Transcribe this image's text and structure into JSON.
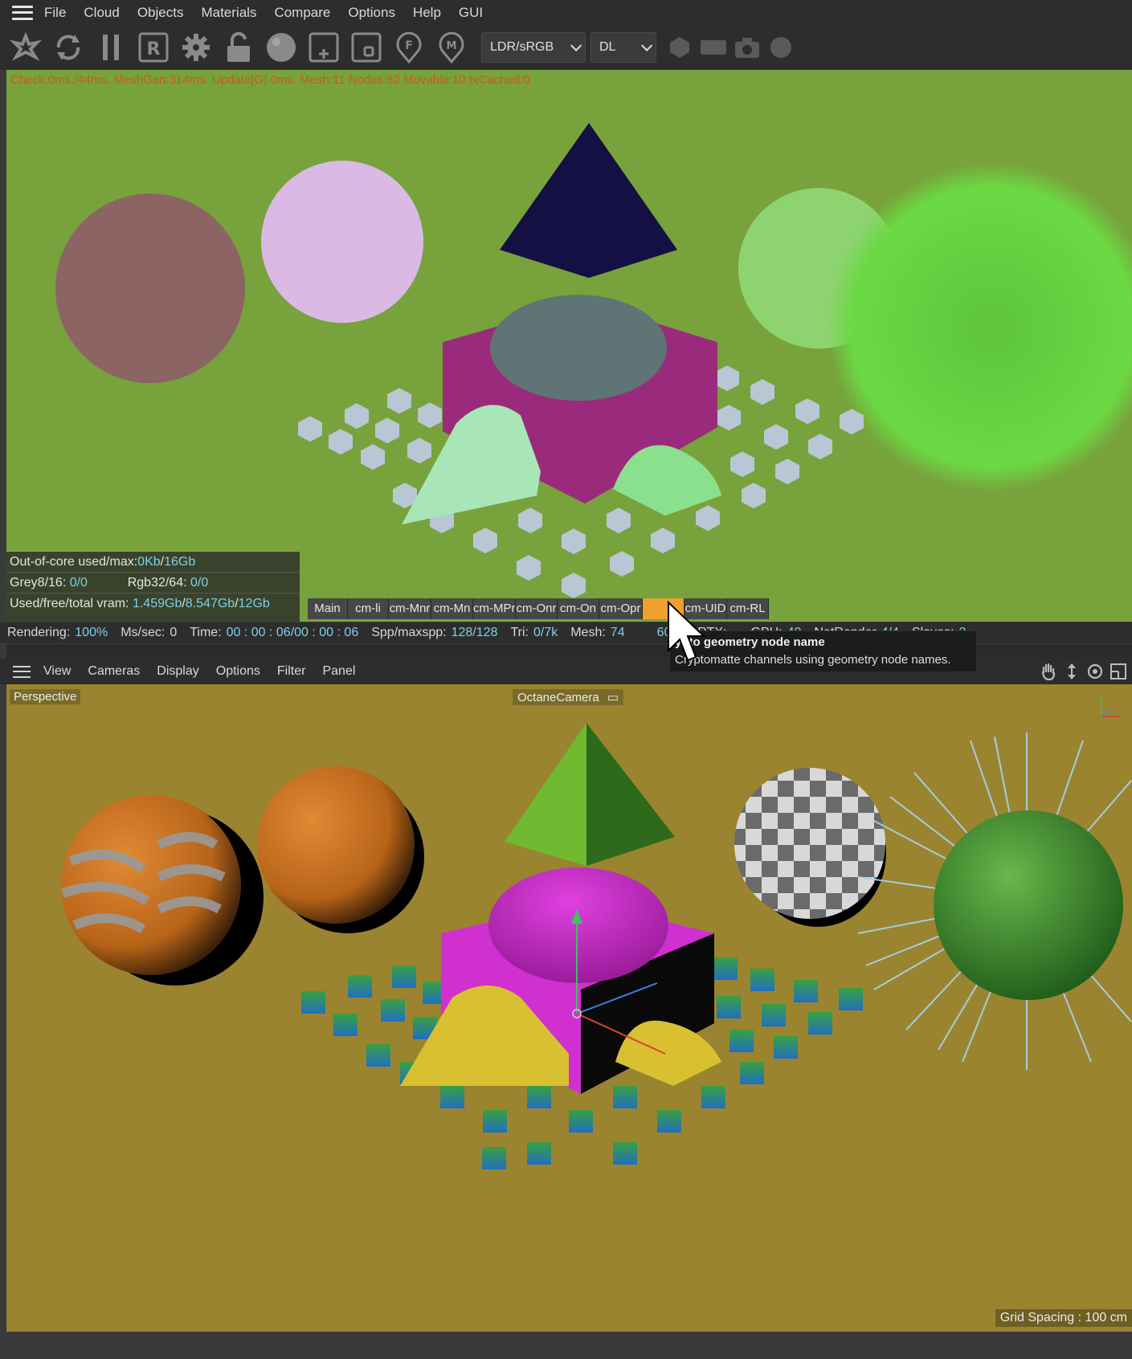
{
  "menu": [
    "File",
    "Cloud",
    "Objects",
    "Materials",
    "Compare",
    "Options",
    "Help",
    "GUI"
  ],
  "toolbar": {
    "icons": [
      "octane-logo-icon",
      "restart-icon",
      "pause-icon",
      "region-render-icon",
      "settings-gear-icon",
      "lock-icon",
      "material-ball-icon",
      "add-region-icon",
      "film-region-icon",
      "focus-picker-icon",
      "material-picker-icon"
    ],
    "color_mode": "LDR/sRGB",
    "kernel": "DL"
  },
  "render": {
    "stats": "Check:0ms./44ms. MeshGen:314ms. Update[G]:0ms. Mesh:11 Nodes:62 Movable:10 txCached:0",
    "out_of_core_label": "Out-of-core used/max:",
    "out_of_core_val1": "0Kb",
    "out_of_core_sep": "/",
    "out_of_core_val2": "16Gb",
    "grey_label": "Grey8/16: ",
    "grey_val": "0/0",
    "rgb_label": "Rgb32/64: ",
    "rgb_val": "0/0",
    "vram_label": "Used/free/total vram: ",
    "vram_val1": "1.459Gb",
    "vram_val2": "8.547Gb",
    "vram_val3": "12Gb",
    "passes": [
      "Main",
      "cm-li",
      "cm-Mnr",
      "cm-Mn",
      "cm-MPr",
      "cm-Onr",
      "cm-On",
      "cm-Opr",
      "cm-",
      "cm-UID",
      "cm-RL"
    ],
    "active_pass_index": 8
  },
  "status": {
    "rendering_label": "Rendering:",
    "rendering_val": "100%",
    "mssec_label": "Ms/sec:",
    "mssec_val": "0",
    "time_label": "Time:",
    "time_val": "00 : 00 : 06/00 : 00 : 06",
    "spp_label": "Spp/maxspp:",
    "spp_val": "128/128",
    "tri_label": "Tri:",
    "tri_val": "0/7k",
    "mesh_label": "Mesh:",
    "mesh_val": "74",
    "hidden_val": "600k",
    "rtx_label": "RTX:",
    "gpu_label": "GPU:",
    "gpu_val": "40",
    "netrender_label": "NetRender",
    "netrender_val": "4/4",
    "slaves_label": "Slaves:",
    "slaves_val": "2"
  },
  "tooltip": {
    "title": "ypto geometry node name",
    "body": "Cryptomatte channels using geometry node names."
  },
  "editor": {
    "menu": [
      "View",
      "Cameras",
      "Display",
      "Options",
      "Filter",
      "Panel"
    ],
    "view_label": "Perspective",
    "camera_label": "OctaneCamera",
    "grid_spacing": "Grid Spacing : 100 cm"
  },
  "colors": {
    "render_bg": "#78a23c",
    "viewport_bg": "#9b8430",
    "active_tab": "#f0a030",
    "value_text": "#7fd0e6"
  }
}
